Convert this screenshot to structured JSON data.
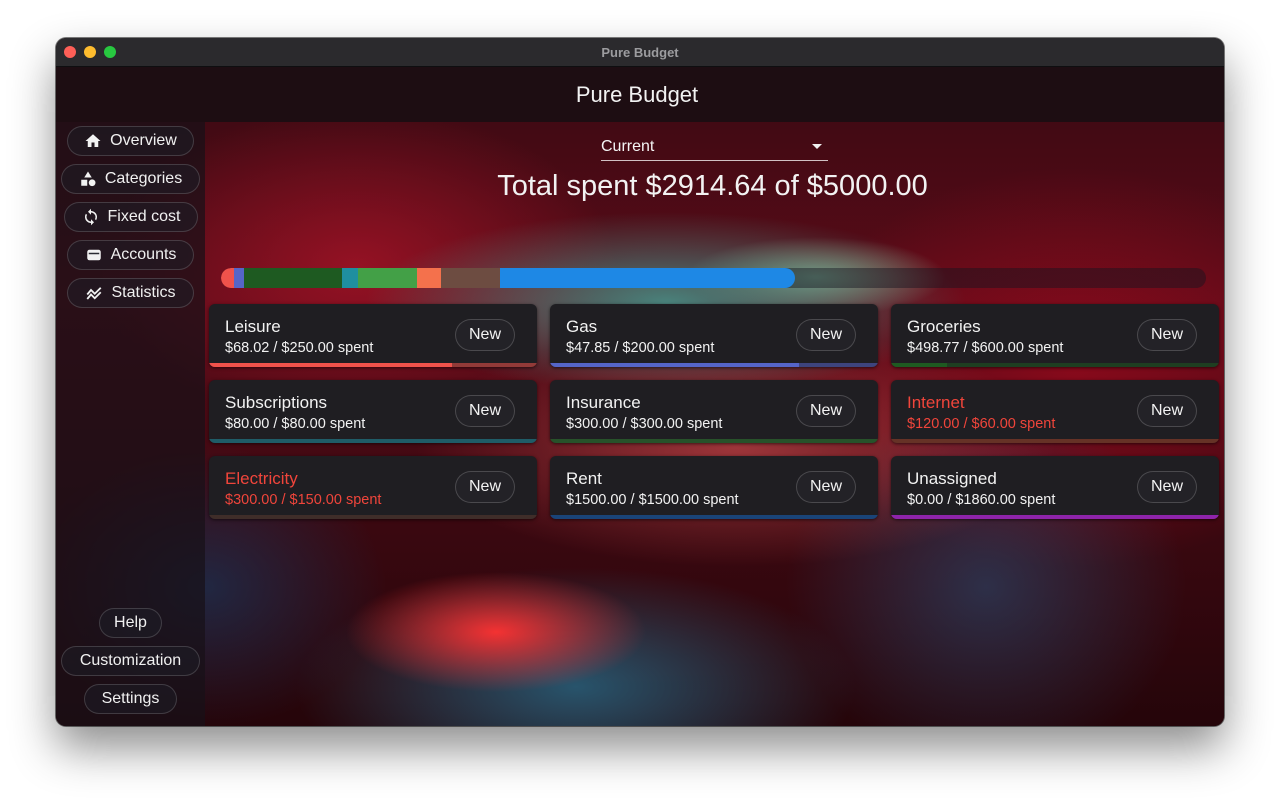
{
  "window": {
    "title": "Pure Budget"
  },
  "header": {
    "title": "Pure Budget"
  },
  "sidebar": {
    "items": [
      {
        "label": "Overview",
        "icon": "home-icon"
      },
      {
        "label": "Categories",
        "icon": "shapes-icon"
      },
      {
        "label": "Fixed cost",
        "icon": "repeat-icon"
      },
      {
        "label": "Accounts",
        "icon": "wallet-icon"
      },
      {
        "label": "Statistics",
        "icon": "chart-line-icon"
      }
    ],
    "bottom": [
      {
        "label": "Help"
      },
      {
        "label": "Customization"
      },
      {
        "label": "Settings"
      }
    ]
  },
  "period_select": {
    "value": "Current"
  },
  "total": {
    "text": "Total spent $2914.64 of $5000.00"
  },
  "spend_bar": {
    "total_budget": 5000.0,
    "segments": [
      {
        "category": "Leisure",
        "value": 68.02,
        "color": "#f0524b"
      },
      {
        "category": "Gas",
        "value": 47.85,
        "color": "#5565c8"
      },
      {
        "category": "Groceries",
        "value": 498.77,
        "color": "#1e5a21"
      },
      {
        "category": "Subscriptions",
        "value": 80.0,
        "color": "#1f8fa0"
      },
      {
        "category": "Insurance",
        "value": 300.0,
        "color": "#43a047"
      },
      {
        "category": "Internet",
        "value": 120.0,
        "color": "#f4714c"
      },
      {
        "category": "Electricity",
        "value": 300.0,
        "color": "#6d4c41"
      },
      {
        "category": "Rent",
        "value": 1500.0,
        "color": "#1e88e5"
      }
    ]
  },
  "categories": [
    {
      "name": "Leisure",
      "amount": "$68.02 / $250.00 spent",
      "new_label": "New",
      "progress": 0.74,
      "color": "#f0524b",
      "over": false
    },
    {
      "name": "Gas",
      "amount": "$47.85 / $200.00 spent",
      "new_label": "New",
      "progress": 0.76,
      "color": "#5565c8",
      "over": false
    },
    {
      "name": "Groceries",
      "amount": "$498.77 / $600.00 spent",
      "new_label": "New",
      "progress": 0.17,
      "color": "#1e5a21",
      "over": false
    },
    {
      "name": "Subscriptions",
      "amount": "$80.00 / $80.00 spent",
      "new_label": "New",
      "progress": 0.0,
      "color": "#1f8fa0",
      "over": false
    },
    {
      "name": "Insurance",
      "amount": "$300.00 / $300.00 spent",
      "new_label": "New",
      "progress": 0.0,
      "color": "#2e7d32",
      "over": false
    },
    {
      "name": "Internet",
      "amount": "$120.00 / $60.00 spent",
      "new_label": "New",
      "progress": 0.0,
      "color": "#a0442a",
      "over": true
    },
    {
      "name": "Electricity",
      "amount": "$300.00 / $150.00 spent",
      "new_label": "New",
      "progress": 0.0,
      "color": "#5a3a30",
      "over": true
    },
    {
      "name": "Rent",
      "amount": "$1500.00 / $1500.00 spent",
      "new_label": "New",
      "progress": 0.0,
      "color": "#1565c0",
      "over": false
    },
    {
      "name": "Unassigned",
      "amount": "$0.00 / $1860.00 spent",
      "new_label": "New",
      "progress": 1.0,
      "color": "#8e24aa",
      "over": false
    }
  ]
}
